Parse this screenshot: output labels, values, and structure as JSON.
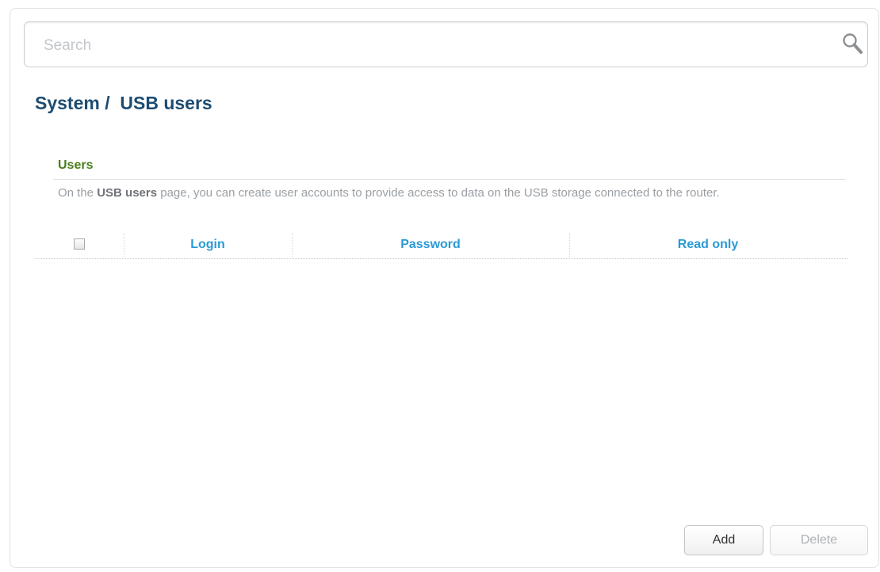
{
  "search": {
    "placeholder": "Search",
    "value": ""
  },
  "breadcrumb": {
    "parent": "System",
    "separator": " /  ",
    "current": "USB users"
  },
  "section": {
    "title": "Users",
    "desc_before": "On the ",
    "desc_bold": "USB users",
    "desc_after": " page, you can create user accounts to provide access to data on the USB storage connected to the router."
  },
  "table": {
    "columns": [
      "Login",
      "Password",
      "Read only"
    ],
    "select_all_checked": false,
    "rows": []
  },
  "actions": {
    "add_label": "Add",
    "delete_label": "Delete"
  },
  "colors": {
    "title": "#1d4c72",
    "section_title": "#4a7f1c",
    "column_header": "#2a9ad6"
  },
  "icons": {
    "search": "search-icon"
  }
}
